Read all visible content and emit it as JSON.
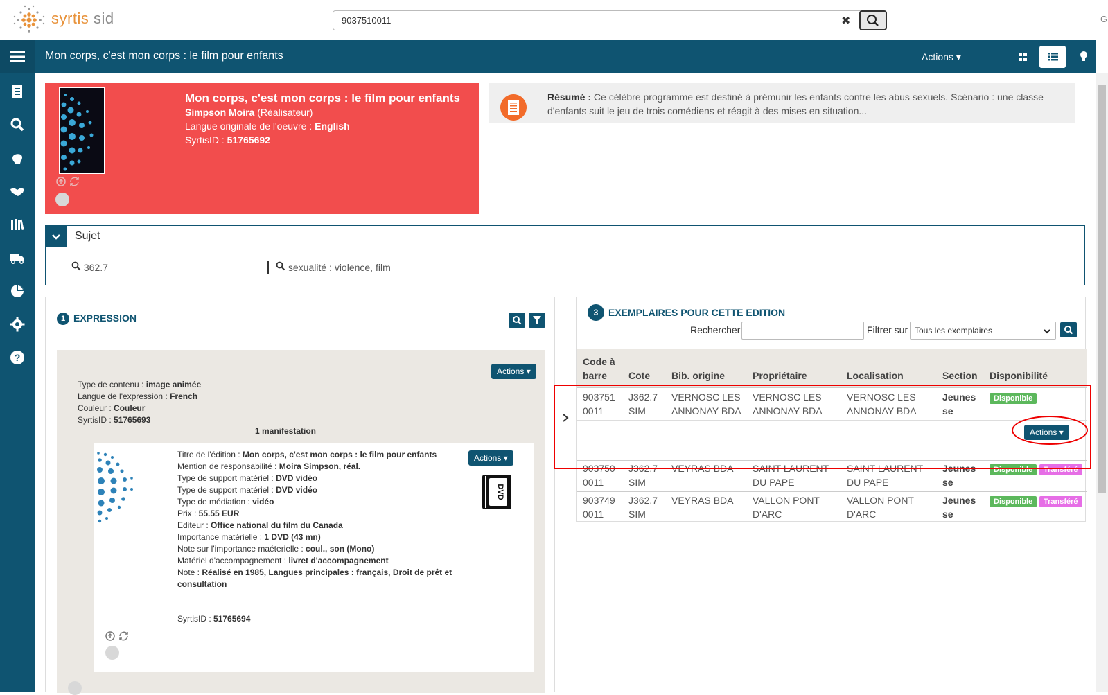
{
  "app": {
    "logo_text_main": "syrtis",
    "logo_text_sub": " sid"
  },
  "search": {
    "value": "9037510011"
  },
  "topbar": {
    "trailing": "G"
  },
  "header": {
    "title": "Mon corps, c'est mon corps : le film pour enfants",
    "actions_label": "Actions"
  },
  "notice": {
    "title": "Mon corps, c'est mon corps : le film pour enfants",
    "author": "Simpson Moira",
    "author_role": " (Réalisateur)",
    "langue_label": "Langue originale de l'oeuvre : ",
    "langue_value": "English",
    "syrtisid_label": "SyrtisID : ",
    "syrtisid_value": "51765692"
  },
  "resume": {
    "label": "Résumé : ",
    "text": "Ce célèbre programme est destiné à prémunir les enfants contre les abus sexuels. Scénario : une classe d'enfants suit le jeu de trois comédiens et réagit à des mises en situation..."
  },
  "sujet": {
    "label": "Sujet",
    "items": [
      "362.7",
      "sexualité : violence, film"
    ]
  },
  "expression": {
    "number": "1",
    "title": "EXPRESSION",
    "actions_label": "Actions",
    "lines": [
      {
        "label": "Type de contenu : ",
        "value": "image animée"
      },
      {
        "label": "Langue de l'expression : ",
        "value": "French"
      },
      {
        "label": "Couleur : ",
        "value": "Couleur"
      },
      {
        "label": "SyrtisID : ",
        "value": "51765693"
      }
    ],
    "manif_count": "1 manifestation"
  },
  "manifestation": {
    "actions_label": "Actions",
    "dvd_label": "DVD",
    "lines": [
      {
        "label": "Titre de l'édition : ",
        "value": "Mon corps, c'est mon corps : le film pour enfants"
      },
      {
        "label": "Mention de responsabilité : ",
        "value": "Moira Simpson, réal."
      },
      {
        "label": "Type de support matériel : ",
        "value": "DVD vidéo"
      },
      {
        "label": "Type de support matériel : ",
        "value": "DVD vidéo"
      },
      {
        "label": "Type de médiation : ",
        "value": "vidéo"
      },
      {
        "label": "Prix : ",
        "value": "55.55 EUR"
      },
      {
        "label": "Editeur : ",
        "value": "Office national du film du Canada"
      },
      {
        "label": "Importance matérielle : ",
        "value": "1 DVD (43 mn)"
      },
      {
        "label": "Note sur l'importance maéterielle : ",
        "value": "coul., son (Mono)"
      },
      {
        "label": "Matériel d'accompagnement : ",
        "value": "livret d'accompagnement"
      },
      {
        "label": "Note : ",
        "value": "Réalisé en 1985,  Langues principales : français,  Droit de prêt et consultation"
      }
    ],
    "syrtisid_label": "SyrtisID : ",
    "syrtisid_value": "51765694"
  },
  "exemplaires": {
    "number": "3",
    "title": "EXEMPLAIRES POUR CETTE EDITION",
    "rechercher_label": "Rechercher",
    "rechercher_value": "",
    "filtre_label": "Filtrer sur",
    "filtre_value": "Tous les exemplaires",
    "columns": [
      "Code à barre",
      "Cote",
      "Bib. origine",
      "Propriétaire",
      "Localisation",
      "Section",
      "Disponibilité"
    ],
    "rows": [
      {
        "code": "903751 0011",
        "cote": "J362.7 SIM",
        "bib": "VERNOSC LES ANNONAY BDA",
        "proprio": "VERNOSC LES ANNONAY BDA",
        "loc": "VERNOSC LES ANNONAY BDA",
        "section": "Jeunes se",
        "dispo": "Disponible",
        "transfert": ""
      },
      {
        "code": "903750 0011",
        "cote": "J362.7 SIM",
        "bib": "VEYRAS BDA",
        "proprio": "SAINT LAURENT DU PAPE",
        "loc": "SAINT LAURENT DU PAPE",
        "section": "Jeunes se",
        "dispo": "Disponible",
        "transfert": "Transféré"
      },
      {
        "code": "903749 0011",
        "cote": "J362.7 SIM",
        "bib": "VEYRAS BDA",
        "proprio": "VALLON PONT D'ARC",
        "loc": "VALLON PONT D'ARC",
        "section": "Jeunes se",
        "dispo": "Disponible",
        "transfert": "Transféré"
      }
    ],
    "row_actions_label": "Actions"
  },
  "colors": {
    "primary": "#0f5471",
    "notice_bg": "#f24d4d",
    "available": "#5cb85c",
    "transferred": "#e66ee6",
    "annotation": "#e00000"
  }
}
